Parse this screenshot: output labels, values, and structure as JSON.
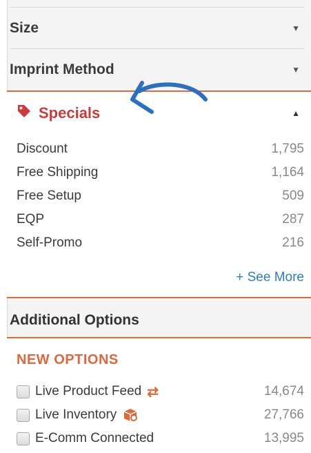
{
  "facets": {
    "size": {
      "label": "Size"
    },
    "imprint": {
      "label": "Imprint Method"
    }
  },
  "specials": {
    "title": "Specials",
    "items": [
      {
        "label": "Discount",
        "count": "1,795"
      },
      {
        "label": "Free Shipping",
        "count": "1,164"
      },
      {
        "label": "Free Setup",
        "count": "509"
      },
      {
        "label": "EQP",
        "count": "287"
      },
      {
        "label": "Self-Promo",
        "count": "216"
      }
    ],
    "see_more": "+ See More"
  },
  "additional": {
    "title": "Additional Options",
    "new_options": "NEW OPTIONS",
    "options": [
      {
        "label": "Live Product Feed",
        "count": "14,674",
        "icon": "swap-arrows-icon"
      },
      {
        "label": "Live Inventory",
        "count": "27,766",
        "icon": "inventory-box-icon"
      },
      {
        "label": "E-Comm Connected",
        "count": "13,995"
      }
    ]
  },
  "colors": {
    "accent_orange": "#e0683a",
    "specials_red": "#cc3b3b",
    "link_blue": "#2a7fc3",
    "annotation_arrow": "#2b6fc0"
  }
}
